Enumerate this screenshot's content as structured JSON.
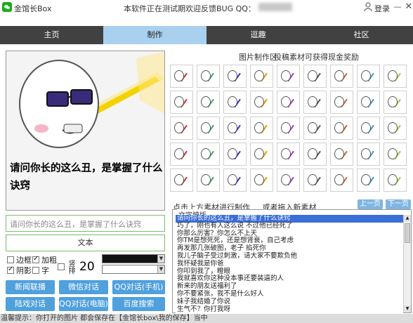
{
  "titlebar": {
    "app_title": "金馆长Box",
    "notice": "本软件正在测试期欢迎反馈BUG QQ：",
    "login": "登录",
    "minimize": "—",
    "close": "✕"
  },
  "tabs": [
    {
      "label": "主页"
    },
    {
      "label": "制作"
    },
    {
      "label": "逗趣"
    },
    {
      "label": "社区"
    }
  ],
  "active_tab": "制作",
  "preview": {
    "caption": "请问你长的这么丑，是掌握了什么诀窍"
  },
  "picture_area": {
    "title": "图片制作区",
    "hint": "投稿素材可获得现金奖励",
    "bottom_hint": "点击上方素材进行制作",
    "drag_hint": "或者拖入新素材",
    "prev_label": "上一页",
    "next_label": "下一页"
  },
  "text_input": {
    "value": "请问你长的这么丑，是掌握了什么诀窍"
  },
  "text_box_label": "文本",
  "options": {
    "border": "边框",
    "bold": "加粗",
    "shadow": "阴影",
    "char": "字",
    "vertical": "竖排",
    "border_checked": false,
    "bold_checked": true,
    "shadow_checked": true,
    "char_checked": false,
    "vertical_checked": false
  },
  "font_size": "20",
  "colors": {
    "accent": "#4fa0dc",
    "active_tab": "#a9d0ef",
    "nav_bg": "#414141",
    "text_color_value": "#111111"
  },
  "actions": [
    {
      "label": "新闻联播"
    },
    {
      "label": "微信对话"
    },
    {
      "label": "QQ对话(手机)"
    },
    {
      "label": "陆戏对话"
    },
    {
      "label": "QQ对话(电脑)"
    },
    {
      "label": "百度搜索"
    }
  ],
  "text_templates": {
    "legend": "文字模版",
    "items": [
      "请问你长的这么丑，是掌握了什么诀窍",
      "巧了，刚也有人这么说 不过他已经死了",
      "你那么厉害？你怎么不上天",
      "你TM是想死死，还是想肾衰，自己考虑",
      "再发那几张破图，老子 掐死你",
      "我儿子脑子受过刺激，请大家不要欺负他",
      "我怀疑我是你爸",
      "你叩到我了，瞪眼",
      "我就喜欢你这种没本事还要装逼的人",
      "新来的朋友送福利了",
      "你不要紧张，我不是什么好人",
      "妹子我结婚了你说",
      "生气不？你打我呀"
    ]
  },
  "statusbar": "温馨提示：你打开的图片 都会保存在【金馆长box\\我的保存】当中"
}
